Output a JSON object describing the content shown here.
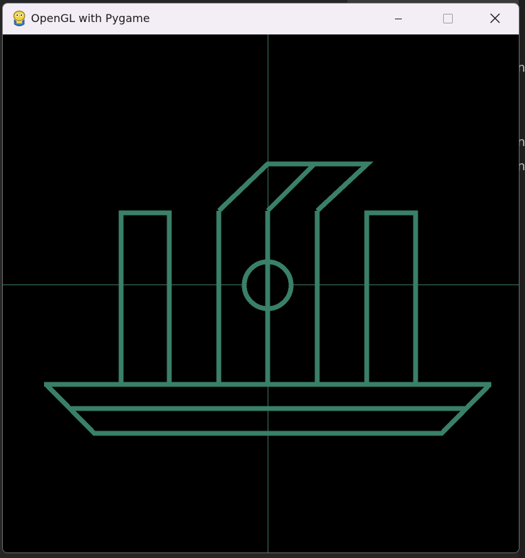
{
  "window": {
    "title": "OpenGL with Pygame",
    "app_icon": "pygame-snake-icon",
    "controls": {
      "minimize_icon": "minimize-icon",
      "maximize_icon": "maximize-icon",
      "close_icon": "close-icon"
    }
  },
  "scene": {
    "background_color": "#000000",
    "line_color": "#3a8068",
    "axes_color": "#3f7a66",
    "objects": [
      "axis-lines",
      "hull-deck",
      "hull-bottom",
      "hull-middle-line",
      "left-smokestack",
      "right-smokestack",
      "center-mast",
      "mast-circle",
      "center-cabin",
      "slanted-sail"
    ]
  }
}
